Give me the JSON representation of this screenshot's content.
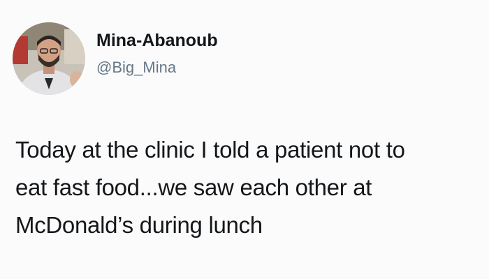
{
  "tweet": {
    "author": {
      "display_name": "Mina-Abanoub",
      "handle": "@Big_Mina"
    },
    "text_lines": [
      "Today at the clinic I told a patient not to",
      "eat fast food...we saw each other at",
      "McDonald’s during lunch"
    ]
  },
  "icons": {
    "avatar": "profile-photo"
  }
}
